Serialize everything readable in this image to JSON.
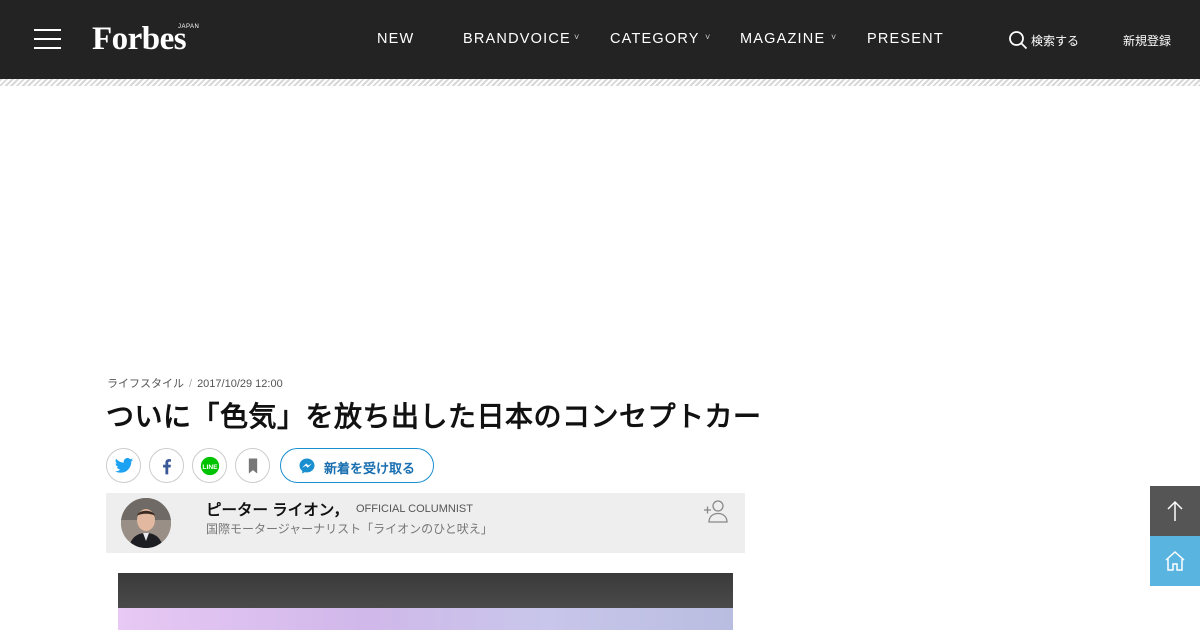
{
  "header": {
    "logo_text": "Forbes",
    "logo_sub": "JAPAN",
    "nav": [
      {
        "label": "NEW"
      },
      {
        "label": "BRANDVOICE"
      },
      {
        "label": "CATEGORY"
      },
      {
        "label": "MAGAZINE"
      },
      {
        "label": "PRESENT"
      }
    ],
    "search_label": "検索する",
    "register_label": "新規登録"
  },
  "article": {
    "category": "ライフスタイル",
    "date": "2017/10/29 12:00",
    "title": "ついに「色気」を放ち出した日本のコンセプトカー"
  },
  "share": {
    "buttons": [
      {
        "icon": "twitter-icon",
        "color": "#1da1f2"
      },
      {
        "icon": "facebook-icon",
        "color": "#3b5998"
      },
      {
        "icon": "line-icon",
        "color": "#00c300"
      },
      {
        "icon": "bookmark-icon",
        "color": "#777777"
      }
    ],
    "messenger_label": "新着を受け取る"
  },
  "author": {
    "name": "ピーター ライオン，",
    "role": "OFFICIAL COLUMNIST",
    "description": "国際モータージャーナリスト「ライオンのひと吠え」"
  },
  "side": {
    "top_button_color": "#555555",
    "home_button_color": "#5ab4e0"
  }
}
